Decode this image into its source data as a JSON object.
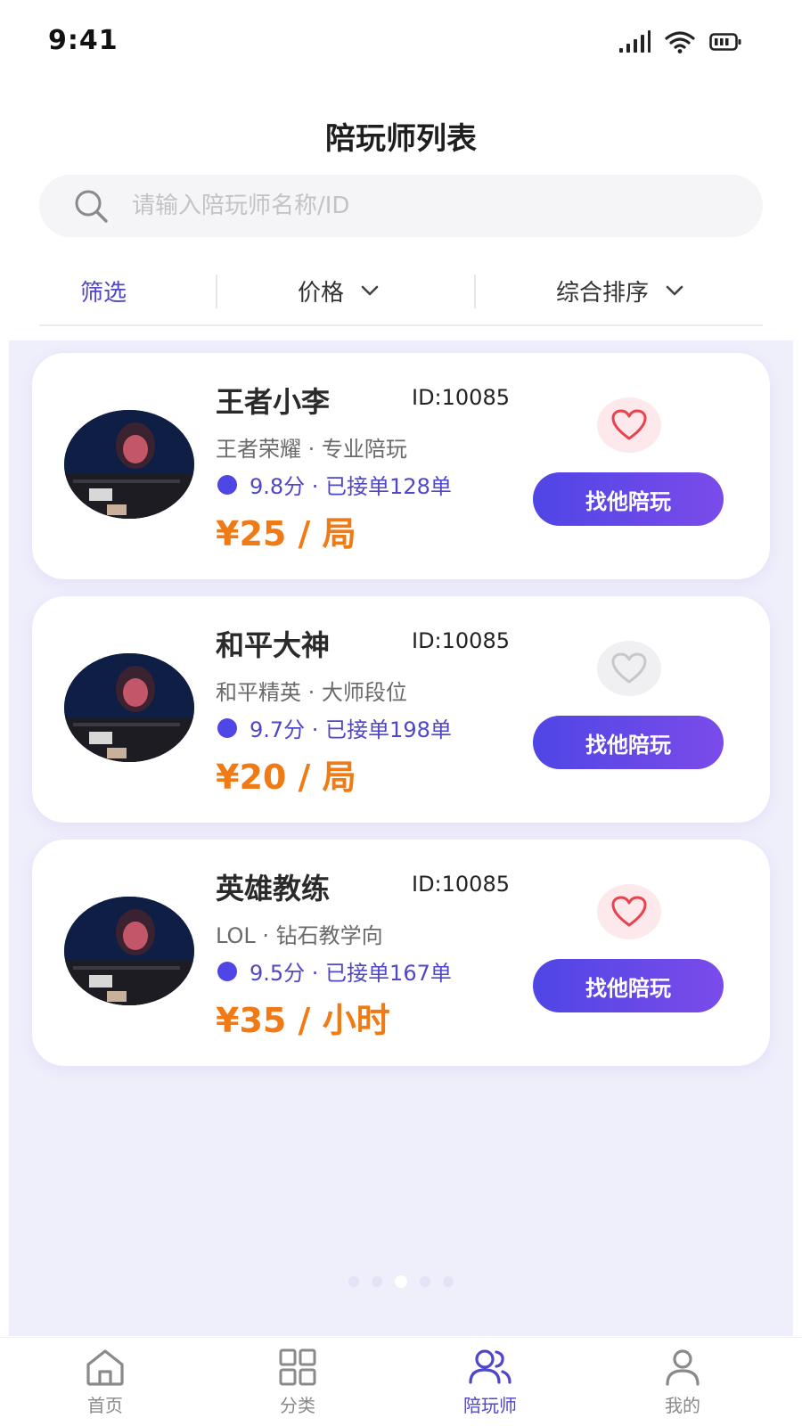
{
  "status_bar": {
    "time": "9:41"
  },
  "header": {
    "title": "陪玩师列表"
  },
  "search": {
    "placeholder": "请输入陪玩师名称/ID"
  },
  "filters": [
    {
      "label": "筛选",
      "active": true
    },
    {
      "label": "价格",
      "active": false
    },
    {
      "label": "综合排序",
      "active": false
    }
  ],
  "players": [
    {
      "name": "王者小李",
      "id_text": "ID:10085",
      "subtitle": "王者荣耀 · 专业陪玩",
      "rating_text": "9.8分 · 已接单128单",
      "price": "¥25 / 局",
      "favorited": true,
      "button_label": "找他陪玩"
    },
    {
      "name": "和平大神",
      "id_text": "ID:10085",
      "subtitle": "和平精英 · 大师段位",
      "rating_text": "9.7分 · 已接单198单",
      "price": "¥20 / 局",
      "favorited": false,
      "button_label": "找他陪玩"
    },
    {
      "name": "英雄教练",
      "id_text": "ID:10085",
      "subtitle": "LOL · 钻石教学向",
      "rating_text": "9.5分 · 已接单167单",
      "price": "¥35 / 小时",
      "favorited": true,
      "button_label": "找他陪玩"
    }
  ],
  "pager": {
    "count": 5,
    "active_index": 2
  },
  "tab_bar": {
    "items": [
      {
        "label": "首页",
        "icon": "home-icon",
        "active": false
      },
      {
        "label": "分类",
        "icon": "grid-icon",
        "active": false
      },
      {
        "label": "陪玩师",
        "icon": "users-icon",
        "active": true
      },
      {
        "label": "我的",
        "icon": "user-icon",
        "active": false
      }
    ]
  },
  "colors": {
    "accent": "#4f46e5",
    "price": "#f07a15",
    "list_bg": "#efeefb",
    "heart_on": "#e8434f",
    "heart_off": "#c8c8cc"
  }
}
